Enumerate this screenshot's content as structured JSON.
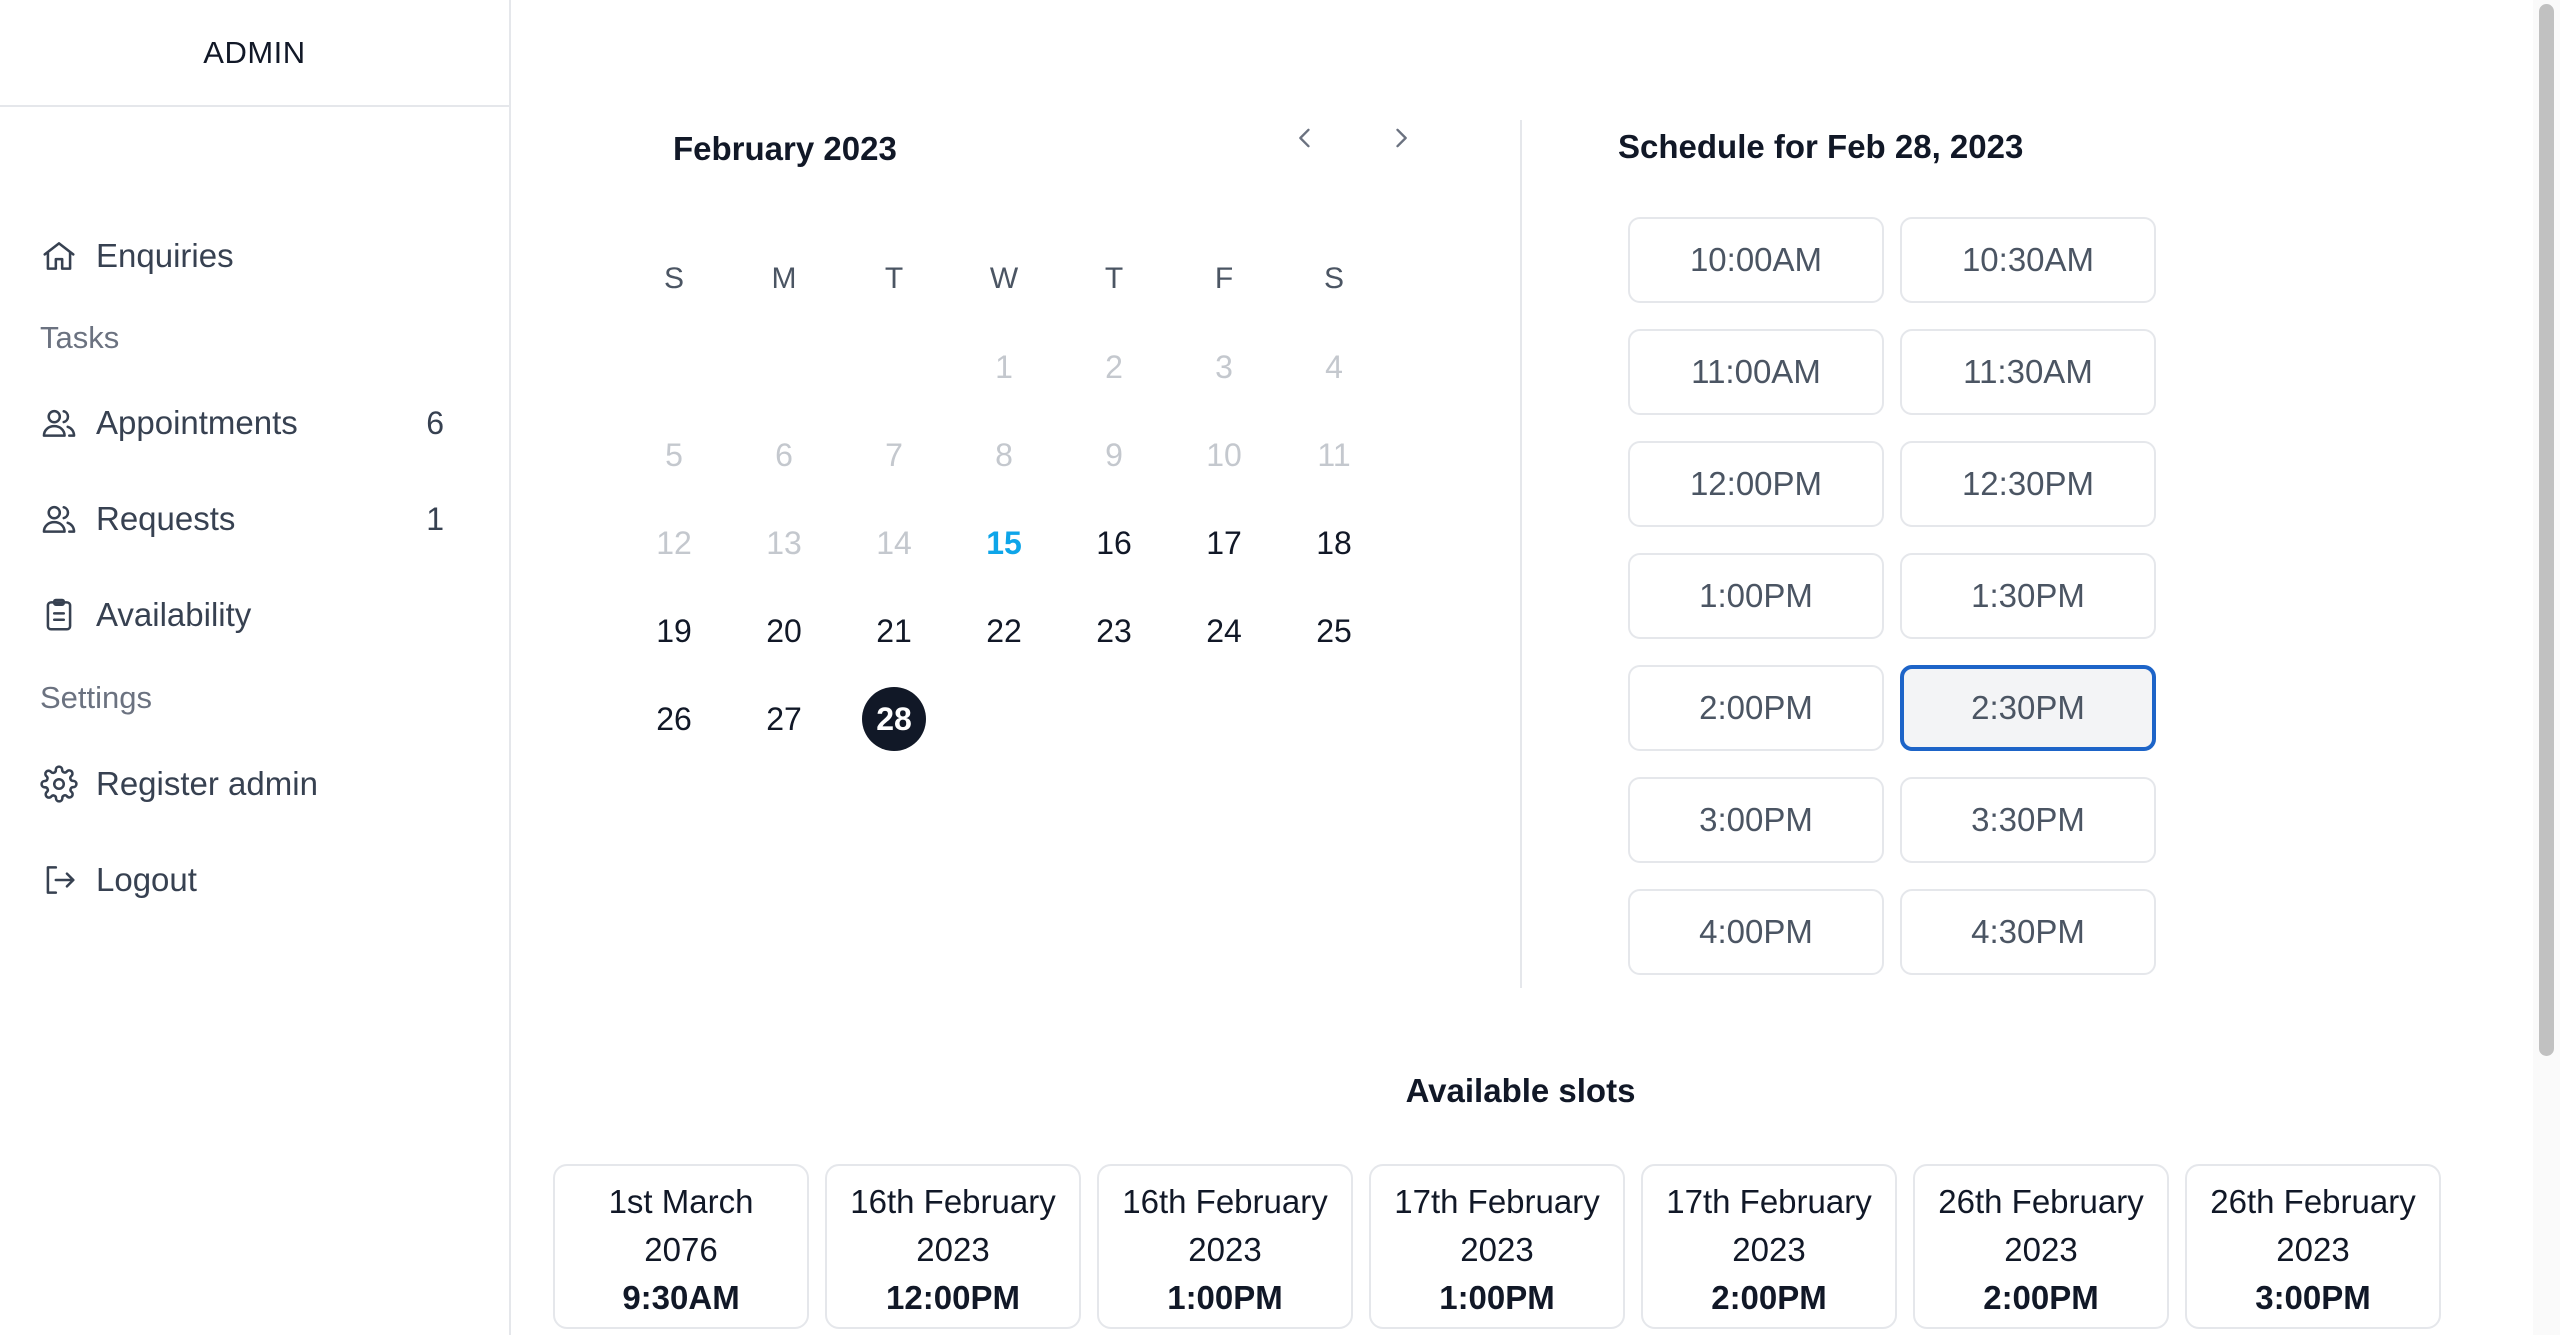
{
  "sidebar": {
    "brand": "ADMIN",
    "items": [
      {
        "label": "Enquiries",
        "icon": "home-icon"
      },
      {
        "label": "Appointments",
        "icon": "users-icon",
        "count": "6"
      },
      {
        "label": "Requests",
        "icon": "users-icon",
        "count": "1"
      },
      {
        "label": "Availability",
        "icon": "clipboard-icon"
      },
      {
        "label": "Register admin",
        "icon": "gear-icon"
      },
      {
        "label": "Logout",
        "icon": "logout-icon"
      }
    ],
    "sections": {
      "tasks": "Tasks",
      "settings": "Settings"
    }
  },
  "calendar": {
    "month_title": "February 2023",
    "weekdays": [
      "S",
      "M",
      "T",
      "W",
      "T",
      "F",
      "S"
    ],
    "days": [
      {
        "label": "1",
        "state": "past"
      },
      {
        "label": "2",
        "state": "past"
      },
      {
        "label": "3",
        "state": "past"
      },
      {
        "label": "4",
        "state": "past"
      },
      {
        "label": "5",
        "state": "past"
      },
      {
        "label": "6",
        "state": "past"
      },
      {
        "label": "7",
        "state": "past"
      },
      {
        "label": "8",
        "state": "past"
      },
      {
        "label": "9",
        "state": "past"
      },
      {
        "label": "10",
        "state": "past"
      },
      {
        "label": "11",
        "state": "past"
      },
      {
        "label": "12",
        "state": "past"
      },
      {
        "label": "13",
        "state": "past"
      },
      {
        "label": "14",
        "state": "past"
      },
      {
        "label": "15",
        "state": "today"
      },
      {
        "label": "16",
        "state": "future"
      },
      {
        "label": "17",
        "state": "future"
      },
      {
        "label": "18",
        "state": "future"
      },
      {
        "label": "19",
        "state": "future"
      },
      {
        "label": "20",
        "state": "future"
      },
      {
        "label": "21",
        "state": "future"
      },
      {
        "label": "22",
        "state": "future"
      },
      {
        "label": "23",
        "state": "future"
      },
      {
        "label": "24",
        "state": "future"
      },
      {
        "label": "25",
        "state": "future"
      },
      {
        "label": "26",
        "state": "future"
      },
      {
        "label": "27",
        "state": "future"
      },
      {
        "label": "28",
        "state": "selected"
      }
    ],
    "first_weekday_index": 3
  },
  "schedule": {
    "title": "Schedule for Feb 28, 2023",
    "slots": [
      "10:00AM",
      "10:30AM",
      "11:00AM",
      "11:30AM",
      "12:00PM",
      "12:30PM",
      "1:00PM",
      "1:30PM",
      "2:00PM",
      "2:30PM",
      "3:00PM",
      "3:30PM",
      "4:00PM",
      "4:30PM"
    ],
    "selected_slot": "2:30PM"
  },
  "available": {
    "title": "Available slots",
    "cards": [
      {
        "date_line1": "1st March",
        "date_line2": "2076",
        "time": "9:30AM"
      },
      {
        "date_line1": "16th February",
        "date_line2": "2023",
        "time": "12:00PM"
      },
      {
        "date_line1": "16th February",
        "date_line2": "2023",
        "time": "1:00PM"
      },
      {
        "date_line1": "17th February",
        "date_line2": "2023",
        "time": "1:00PM"
      },
      {
        "date_line1": "17th February",
        "date_line2": "2023",
        "time": "2:00PM"
      },
      {
        "date_line1": "26th February",
        "date_line2": "2023",
        "time": "2:00PM"
      },
      {
        "date_line1": "26th February",
        "date_line2": "2023",
        "time": "3:00PM"
      }
    ]
  },
  "colors": {
    "accent_today": "#0ea5e9",
    "selected_day_bg": "#111827",
    "selected_slot_border": "#1d64c8"
  }
}
